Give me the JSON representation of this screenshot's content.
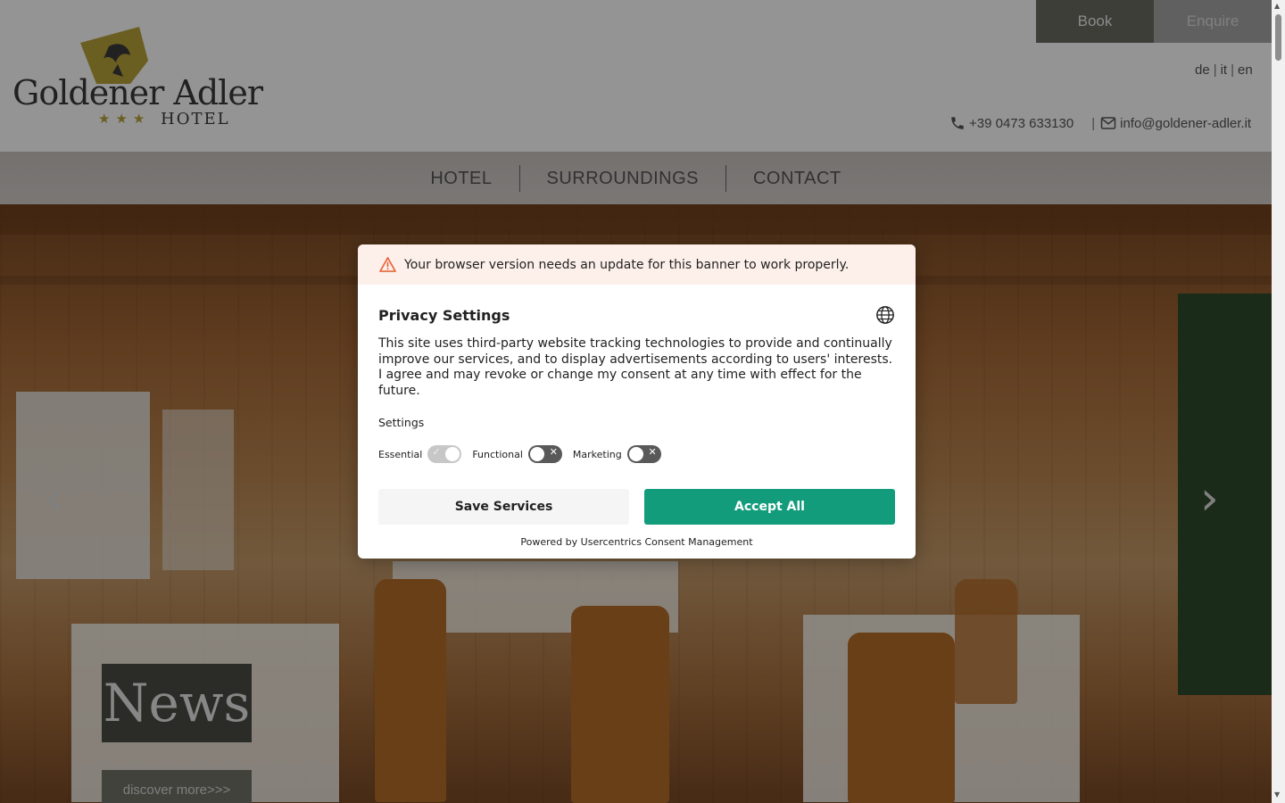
{
  "logo": {
    "name": "Goldener Adler",
    "stars": "★★★",
    "sub": "HOTEL"
  },
  "header": {
    "book_label": "Book",
    "enquire_label": "Enquire",
    "languages": [
      "de",
      "it",
      "en"
    ],
    "phone": "+39 0473 633130",
    "email": "info@goldener-adler.it",
    "divider": "|"
  },
  "nav": {
    "items": [
      "HOTEL",
      "SURROUNDINGS",
      "CONTACT"
    ]
  },
  "hero": {
    "prev_arrow": "‹",
    "next_arrow": "›",
    "news_title": "News",
    "discover_label": "discover more>>>"
  },
  "consent": {
    "warning": "Your browser version needs an update for this banner to work properly.",
    "title": "Privacy Settings",
    "text": "This site uses third-party website tracking technologies to provide and continually improve our services, and to display advertisements according to users' interests. I agree and may revoke or change my consent at any time with effect for the future.",
    "settings_label": "Settings",
    "toggles": [
      {
        "label": "Essential",
        "state": "on-disabled"
      },
      {
        "label": "Functional",
        "state": "off"
      },
      {
        "label": "Marketing",
        "state": "off"
      }
    ],
    "save_label": "Save Services",
    "accept_label": "Accept All",
    "powered_by": "Powered by Usercentrics Consent Management"
  },
  "colors": {
    "accept_green": "#139c7b",
    "warning_orange": "#e8673c",
    "logo_gold": "#b8a23a"
  }
}
